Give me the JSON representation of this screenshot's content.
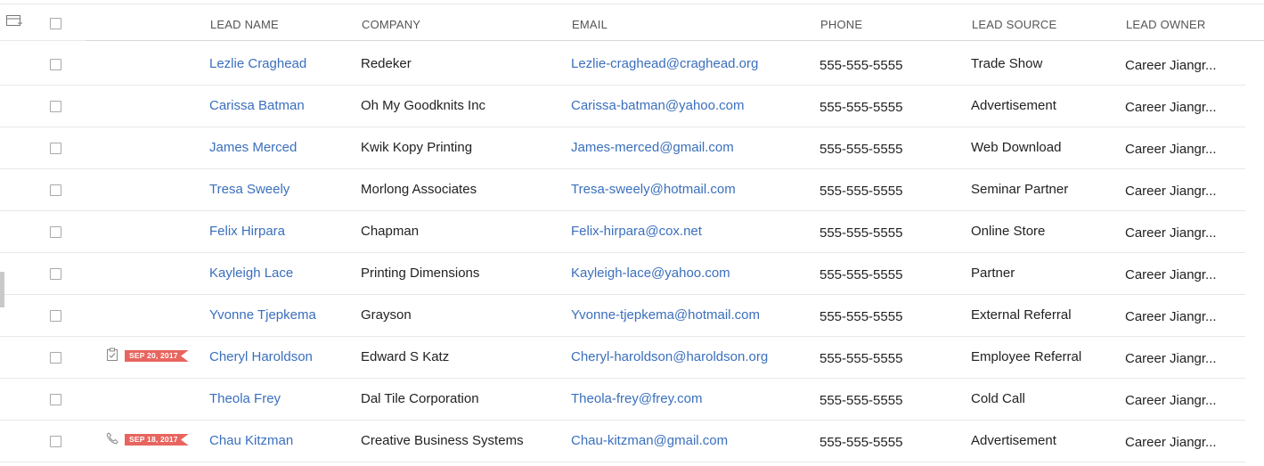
{
  "header": {
    "columns": [
      "LEAD NAME",
      "COMPANY",
      "EMAIL",
      "PHONE",
      "LEAD SOURCE",
      "LEAD OWNER"
    ]
  },
  "rows": [
    {
      "name": "Lezlie Craghead",
      "company": "Redeker",
      "email": "Lezlie-craghead@craghead.org",
      "phone": "555-555-5555",
      "source": "Trade Show",
      "owner": "Career Jiangr...",
      "tag": null
    },
    {
      "name": "Carissa Batman",
      "company": "Oh My Goodknits Inc",
      "email": "Carissa-batman@yahoo.com",
      "phone": "555-555-5555",
      "source": "Advertisement",
      "owner": "Career Jiangr...",
      "tag": null
    },
    {
      "name": "James Merced",
      "company": "Kwik Kopy Printing",
      "email": "James-merced@gmail.com",
      "phone": "555-555-5555",
      "source": "Web Download",
      "owner": "Career Jiangr...",
      "tag": null
    },
    {
      "name": "Tresa Sweely",
      "company": "Morlong Associates",
      "email": "Tresa-sweely@hotmail.com",
      "phone": "555-555-5555",
      "source": "Seminar Partner",
      "owner": "Career Jiangr...",
      "tag": null
    },
    {
      "name": "Felix Hirpara",
      "company": "Chapman",
      "email": "Felix-hirpara@cox.net",
      "phone": "555-555-5555",
      "source": "Online Store",
      "owner": "Career Jiangr...",
      "tag": null
    },
    {
      "name": "Kayleigh Lace",
      "company": "Printing Dimensions",
      "email": "Kayleigh-lace@yahoo.com",
      "phone": "555-555-5555",
      "source": "Partner",
      "owner": "Career Jiangr...",
      "tag": null
    },
    {
      "name": "Yvonne Tjepkema",
      "company": "Grayson",
      "email": "Yvonne-tjepkema@hotmail.com",
      "phone": "555-555-5555",
      "source": "External Referral",
      "owner": "Career Jiangr...",
      "tag": null
    },
    {
      "name": "Cheryl Haroldson",
      "company": "Edward S Katz",
      "email": "Cheryl-haroldson@haroldson.org",
      "phone": "555-555-5555",
      "source": "Employee Referral",
      "owner": "Career Jiangr...",
      "tag": {
        "icon": "task-icon",
        "date": "SEP 20, 2017"
      }
    },
    {
      "name": "Theola Frey",
      "company": "Dal Tile Corporation",
      "email": "Theola-frey@frey.com",
      "phone": "555-555-5555",
      "source": "Cold Call",
      "owner": "Career Jiangr...",
      "tag": null
    },
    {
      "name": "Chau Kitzman",
      "company": "Creative Business Systems",
      "email": "Chau-kitzman@gmail.com",
      "phone": "555-555-5555",
      "source": "Advertisement",
      "owner": "Career Jiangr...",
      "tag": {
        "icon": "phone-call-icon",
        "date": "SEP 18, 2017"
      }
    }
  ],
  "colors": {
    "link": "#3a6fbd",
    "ribbon": "#e8655f",
    "text": "#222222",
    "header_text": "#555555"
  }
}
